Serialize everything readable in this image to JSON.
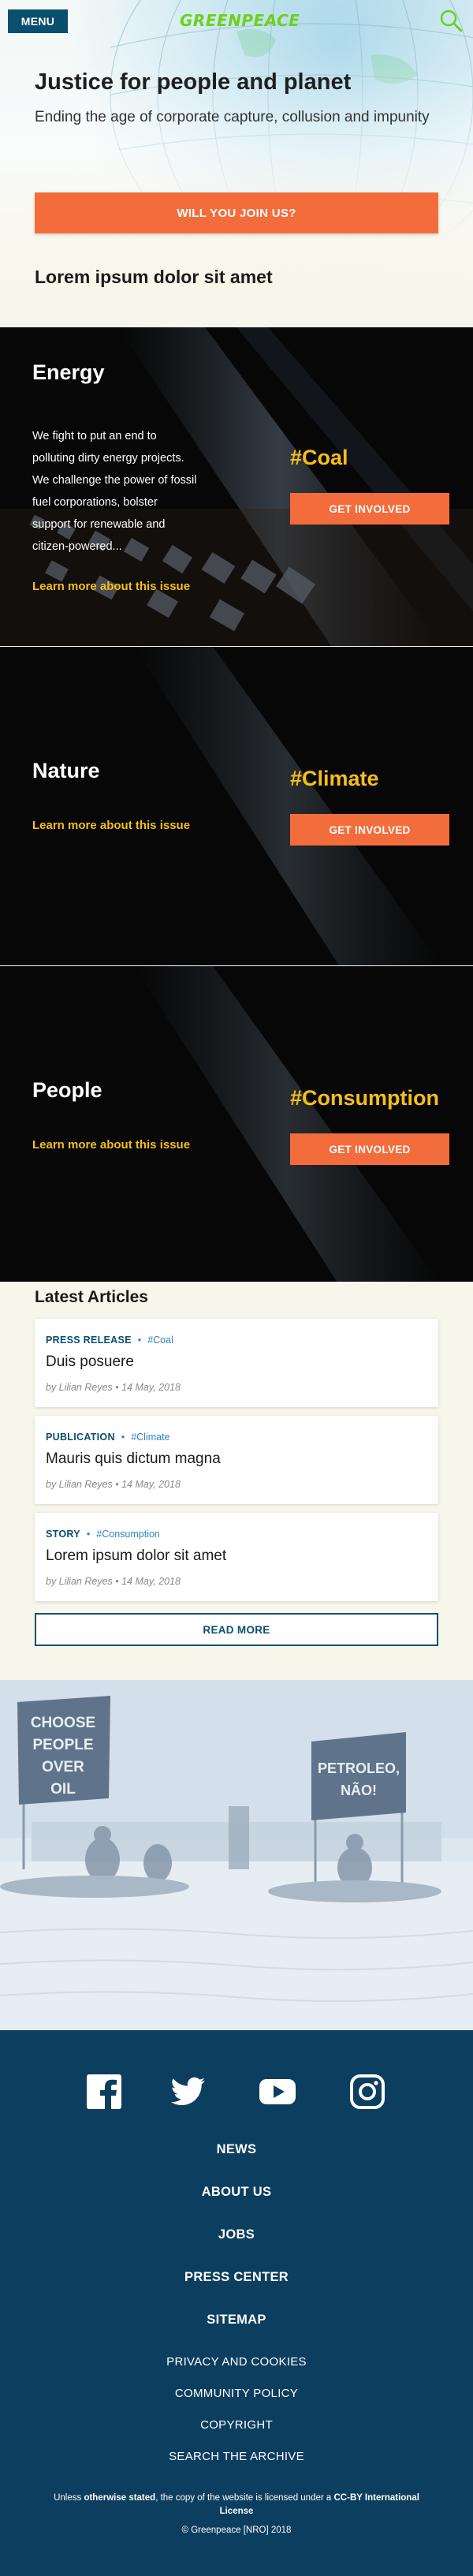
{
  "header": {
    "menu_label": "MENU",
    "logo_text": "GREENPEACE",
    "search_icon": "search-icon"
  },
  "hero": {
    "title": "Justice for people and planet",
    "subtitle": "Ending the age of corporate capture, collusion and impunity",
    "cta_label": "WILL YOU JOIN US?",
    "section_heading": "Lorem ipsum dolor sit amet"
  },
  "issues": [
    {
      "title": "Energy",
      "description": "We fight to put an end to polluting dirty energy projects. We challenge the power of fossil fuel corporations, bolster support for renewable and citizen-powered...",
      "link": "Learn more about this issue",
      "tag": "#Coal",
      "button": "GET INVOLVED"
    },
    {
      "title": "Nature",
      "link": "Learn more about this issue",
      "tag": "#Climate",
      "button": "GET INVOLVED"
    },
    {
      "title": "People",
      "link": "Learn more about this issue",
      "tag": "#Consumption",
      "button": "GET INVOLVED"
    }
  ],
  "articles": {
    "heading": "Latest Articles",
    "items": [
      {
        "type": "PRESS RELEASE",
        "tag": "#Coal",
        "title": "Duis posuere",
        "byline": "by Lilian Reyes • 14 May, 2018"
      },
      {
        "type": "PUBLICATION",
        "tag": "#Climate",
        "title": "Mauris quis dictum magna",
        "byline": "by Lilian Reyes • 14 May, 2018"
      },
      {
        "type": "STORY",
        "tag": "#Consumption",
        "title": "Lorem ipsum dolor sit amet",
        "byline": "by Lilian Reyes • 14 May, 2018"
      }
    ],
    "read_more": "READ MORE"
  },
  "photo": {
    "sign_left": "CHOOSE PEOPLE OVER OIL",
    "sign_right": "PETROLEO, NÃO!"
  },
  "footer": {
    "social": [
      "facebook-icon",
      "twitter-icon",
      "youtube-icon",
      "instagram-icon"
    ],
    "main_links": [
      "NEWS",
      "ABOUT US",
      "JOBS",
      "PRESS CENTER",
      "SITEMAP"
    ],
    "secondary_links": [
      "PRIVACY AND COOKIES",
      "COMMUNITY POLICY",
      "COPYRIGHT",
      "SEARCH THE ARCHIVE"
    ],
    "license_pre": "Unless ",
    "license_bold1": "otherwise stated",
    "license_mid": ", the copy of the website is licensed under a ",
    "license_bold2": "CC-BY International License",
    "copyright": "© Greenpeace [NRO] 2018"
  },
  "colors": {
    "accent_orange": "#f36d3c",
    "tag_yellow": "#f5bf19",
    "brand_blue": "#0a4f6e",
    "footer_blue": "#0c3e5f",
    "logo_green": "#6ed01b"
  }
}
